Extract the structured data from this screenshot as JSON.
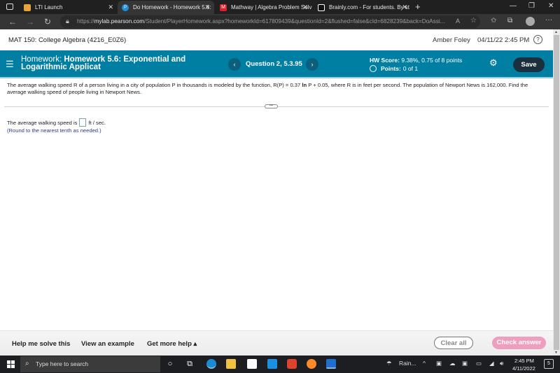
{
  "browser": {
    "tabs": [
      {
        "label": "LTI Launch",
        "favicon_color": "#e8a33d",
        "active": false
      },
      {
        "label": "Do Homework - Homework 5.6:",
        "favicon_color": "#1f8fd8",
        "active": true
      },
      {
        "label": "Mathway | Algebra Problem Solv",
        "favicon_color": "#d8212d",
        "active": false
      },
      {
        "label": "Brainly.com - For students. By st",
        "favicon_color": "#111111",
        "active": false
      }
    ],
    "new_tab_label": "+",
    "url_prefix": "https://",
    "url_host": "mylab.pearson.com",
    "url_path": "/Student/PlayerHomework.aspx?homeworkId=617809439&questionId=2&flushed=false&cId=6828239&back=DoAssi..."
  },
  "course": {
    "title": "MAT 150: College Algebra (4216_E0Z6)",
    "user_name": "Amber Foley",
    "datetime": "04/11/22 2:45 PM",
    "help_label": "?"
  },
  "header": {
    "homework_label": "Homework:",
    "homework_title": "Homework 5.6: Exponential and Logarithmic Applicat",
    "question_label": "Question 2, 5.3.95",
    "prev_label": "‹",
    "next_label": "›",
    "hw_score_label": "HW Score:",
    "hw_score_value": "9.38%, 0.75 of 8 points",
    "points_label": "Points:",
    "points_value": "0 of 1",
    "save_label": "Save",
    "accent_color": "#007fa3"
  },
  "question": {
    "text_before": "The average walking speed R of a person living in a city of population P in thousands is modeled by the function, R(P) = 0.37",
    "ln": "ln",
    "text_after": "P  + 0.05, where R is in feet per second. The population of Newport News is 162,000. Find the average walking speed of people living in Newport News.",
    "divider_handle": "•••",
    "answer_prefix": "The average walking speed is",
    "answer_value": "",
    "answer_unit": "ft / sec.",
    "hint": "(Round to the nearest tenth as needed.)"
  },
  "footer": {
    "help_me_solve": "Help me solve this",
    "view_example": "View an example",
    "get_more_help": "Get more help ▴",
    "clear_all": "Clear all",
    "check_answer": "Check answer"
  },
  "taskbar": {
    "search_placeholder": "Type here to search",
    "weather": "Rain...",
    "time": "2:45 PM",
    "date": "4/11/2022",
    "notification_count": "5"
  }
}
